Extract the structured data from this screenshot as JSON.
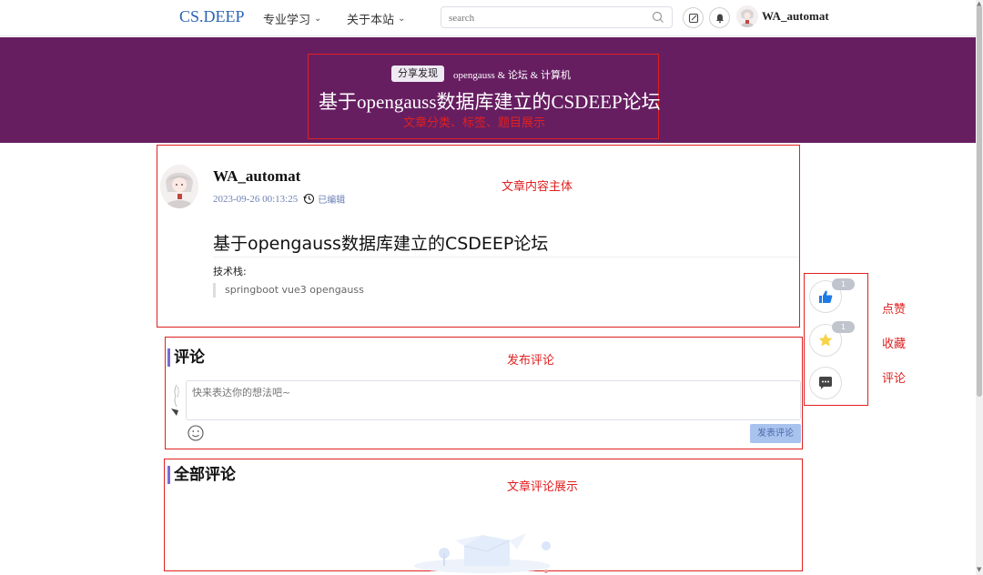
{
  "nav": {
    "logo": "CS.DEEP",
    "menu": [
      {
        "label": "专业学习"
      },
      {
        "label": "关于本站"
      }
    ],
    "search_placeholder": "search",
    "username": "WA_automat"
  },
  "banner": {
    "category": "分享发现",
    "tags": "opengauss & 论坛 & 计算机",
    "title": "基于opengauss数据库建立的CSDEEP论坛",
    "annotation": "文章分类、标签、题目展示"
  },
  "article": {
    "author": "WA_automat",
    "datetime": "2023-09-26 00:13:25",
    "edited": "已编辑",
    "title": "基于opengauss数据库建立的CSDEEP论坛",
    "stack_label": "技术栈:",
    "stack_value": "springboot vue3 opengauss",
    "annotation": "文章内容主体"
  },
  "actions": {
    "like_count": "1",
    "favorite_count": "1",
    "annotations": {
      "like": "点赞",
      "favorite": "收藏",
      "comment": "评论"
    }
  },
  "comment_form": {
    "title": "评论",
    "placeholder": "快来表达你的想法吧~",
    "submit": "发表评论",
    "annotation": "发布评论"
  },
  "all_comments": {
    "title": "全部评论",
    "annotation": "文章评论展示"
  },
  "colors": {
    "banner_bg": "#661e61",
    "logo": "#2b63b5",
    "annotation_red": "#e02020",
    "like_blue": "#1e7be6",
    "star_yellow": "#f7d34a"
  }
}
